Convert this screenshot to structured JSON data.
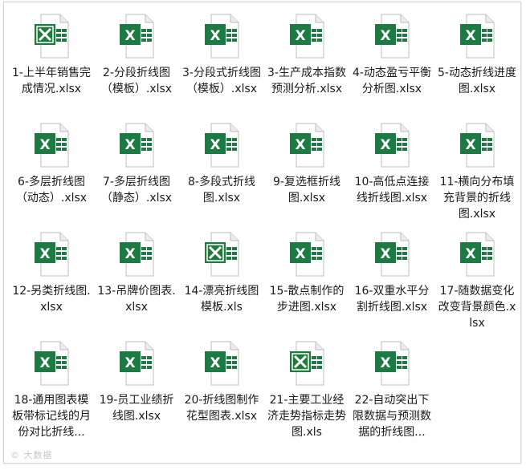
{
  "files": [
    {
      "name": "1-上半年销售完成情况.xlsx",
      "icon": "excel-2003-icon"
    },
    {
      "name": "2-分段折线图（模板）.xlsx",
      "icon": "excel-icon"
    },
    {
      "name": "3-分段式折线图（模板）.xlsx",
      "icon": "excel-icon"
    },
    {
      "name": "3-生产成本指数预测分析.xlsx",
      "icon": "excel-icon"
    },
    {
      "name": "4-动态盈亏平衡分析图.xlsx",
      "icon": "excel-icon"
    },
    {
      "name": "5-动态折线进度图.xlsx",
      "icon": "excel-icon"
    },
    {
      "name": "6-多层折线图（动态）.xlsx",
      "icon": "excel-icon"
    },
    {
      "name": "7-多层折线图（静态）.xlsx",
      "icon": "excel-icon"
    },
    {
      "name": "8-多段式折线图.xlsx",
      "icon": "excel-icon"
    },
    {
      "name": "9-复选框折线图.xlsx",
      "icon": "excel-icon"
    },
    {
      "name": "10-高低点连接线折线图.xlsx",
      "icon": "excel-icon"
    },
    {
      "name": "11-横向分布填充背景的折线图.xlsx",
      "icon": "excel-icon"
    },
    {
      "name": "12-另类折线图.xlsx",
      "icon": "excel-icon"
    },
    {
      "name": "13-吊牌价图表.xlsx",
      "icon": "excel-icon"
    },
    {
      "name": "14-漂亮折线图模板.xls",
      "icon": "excel-2003-icon"
    },
    {
      "name": "15-散点制作的步进图.xlsx",
      "icon": "excel-icon"
    },
    {
      "name": "16-双重水平分割折线图.xlsx",
      "icon": "excel-icon"
    },
    {
      "name": "17-随数据变化改变背景颜色.xlsx",
      "icon": "excel-icon"
    },
    {
      "name": "18-通用图表模板带标记线的月份对比折线...",
      "icon": "excel-icon"
    },
    {
      "name": "19-员工业绩折线图.xlsx",
      "icon": "excel-icon"
    },
    {
      "name": "20-折线图制作花型图表.xlsx",
      "icon": "excel-icon"
    },
    {
      "name": "21-主要工业经济走势指标走势图.xls",
      "icon": "excel-2003-icon"
    },
    {
      "name": "22-自动突出下限数据与预测数据的折线图...",
      "icon": "excel-icon"
    }
  ],
  "watermark": "© 大数据",
  "colors": {
    "excel_green": "#1d7a43",
    "excel_dark": "#185c37",
    "page_fold": "#d9d9d9"
  }
}
